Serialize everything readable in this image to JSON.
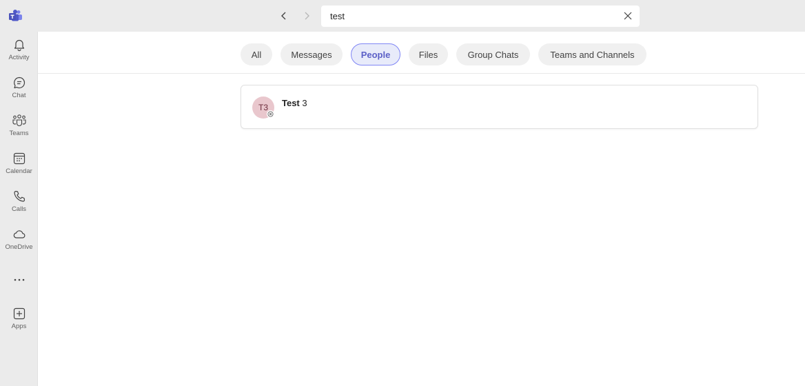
{
  "search": {
    "value": "test"
  },
  "rail": {
    "items": [
      {
        "label": "Activity",
        "icon": "bell-icon"
      },
      {
        "label": "Chat",
        "icon": "chat-icon"
      },
      {
        "label": "Teams",
        "icon": "teams-icon"
      },
      {
        "label": "Calendar",
        "icon": "calendar-icon"
      },
      {
        "label": "Calls",
        "icon": "phone-icon"
      },
      {
        "label": "OneDrive",
        "icon": "cloud-icon"
      }
    ],
    "more": "...",
    "apps": {
      "label": "Apps",
      "icon": "apps-add-icon"
    }
  },
  "filters": {
    "all": "All",
    "messages": "Messages",
    "people": "People",
    "files": "Files",
    "group_chats": "Group Chats",
    "teams_channels": "Teams and Channels",
    "active": "People"
  },
  "results": [
    {
      "initials": "T3",
      "name_bold": "Test",
      "name_rest": " 3",
      "presence": "offline"
    }
  ],
  "colors": {
    "accent": "#5b5fc7",
    "avatar_bg": "#e9c7cd",
    "rail_bg": "#ebebeb"
  }
}
